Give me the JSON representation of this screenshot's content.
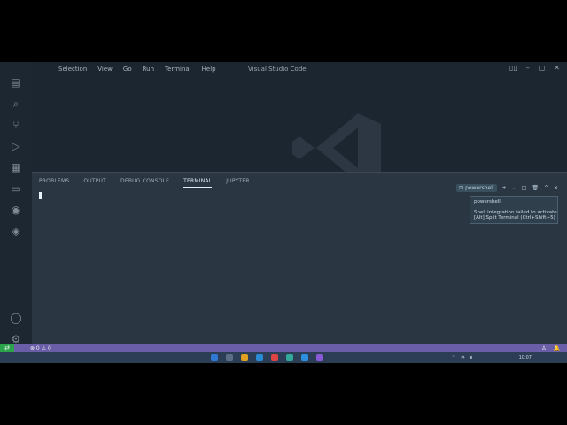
{
  "window": {
    "title": "Visual Studio Code",
    "menu": [
      "Selection",
      "View",
      "Go",
      "Run",
      "Terminal",
      "Help"
    ]
  },
  "panel": {
    "tabs": [
      {
        "label": "PROBLEMS",
        "active": false
      },
      {
        "label": "OUTPUT",
        "active": false
      },
      {
        "label": "DEBUG CONSOLE",
        "active": false
      },
      {
        "label": "TERMINAL",
        "active": true
      },
      {
        "label": "JUPYTER",
        "active": false
      }
    ],
    "terminal_profile": "powershell"
  },
  "tooltip": {
    "title": "powershell",
    "line1": "Shell integration failed to activate",
    "line2": "[Alt] Split Terminal (Ctrl+Shift+5)"
  },
  "status": {
    "problems": "⊗ 0 ⚠ 0",
    "right_icons": [
      "person-icon",
      "bell-icon"
    ]
  },
  "taskbar": {
    "time": "10:07"
  },
  "colors": {
    "status_bar": "#6a5ea8",
    "remote_indicator": "#2aa34a",
    "panel_bg": "#2a3641",
    "editor_bg": "#1c2631"
  }
}
